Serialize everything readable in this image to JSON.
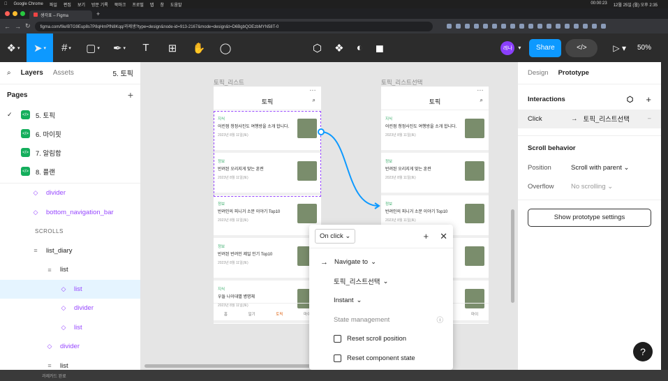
{
  "menubar": {
    "apple": "",
    "app": "Google Chrome",
    "items": [
      "파일",
      "편집",
      "보기",
      "방문 기록",
      "북마크",
      "프로필",
      "탭",
      "창",
      "도움말"
    ],
    "time": "00:00:23",
    "clock": "12월 25일 (월) 오후 2:35"
  },
  "browser": {
    "tab_title": "생각표 – Figma",
    "url": "figma.com/file/BTG9Eup8s7P8qHmPfN8Kqq/과제생?type=design&node-id=913-2167&mode=design&t=D6BgbQOEzbMYN58T-0"
  },
  "toolbar": {
    "zoom": "50%",
    "share": "Share",
    "avatar": "레나"
  },
  "left_panel": {
    "tabs": {
      "layers": "Layers",
      "assets": "Assets",
      "page": "5. 토픽"
    },
    "pages_title": "Pages",
    "pages": [
      {
        "label": "5. 토픽",
        "current": true
      },
      {
        "label": "6. 마이핏",
        "current": false
      },
      {
        "label": "7. 알림함",
        "current": false
      },
      {
        "label": "8. 플랜",
        "current": false
      }
    ],
    "layers": [
      {
        "label": "divider",
        "indent": 52,
        "icon": "◇",
        "purple": true,
        "selected": false
      },
      {
        "label": "bottom_navigation_bar",
        "indent": 52,
        "icon": "◇",
        "purple": true,
        "selected": false
      },
      {
        "label": "SCROLLS",
        "indent": 50,
        "icon": "",
        "purple": false,
        "selected": false,
        "head": true
      },
      {
        "label": "list_diary",
        "indent": 52,
        "icon": "≡",
        "purple": false,
        "selected": false
      },
      {
        "label": "list",
        "indent": 72,
        "icon": "≡",
        "purple": false,
        "selected": false
      },
      {
        "label": "list",
        "indent": 92,
        "icon": "◇",
        "purple": true,
        "selected": true
      },
      {
        "label": "divider",
        "indent": 92,
        "icon": "◇",
        "purple": true,
        "selected": false
      },
      {
        "label": "list",
        "indent": 92,
        "icon": "◇",
        "purple": true,
        "selected": false
      },
      {
        "label": "divider",
        "indent": 72,
        "icon": "◇",
        "purple": true,
        "selected": false
      },
      {
        "label": "list",
        "indent": 72,
        "icon": "≡",
        "purple": false,
        "selected": false
      }
    ]
  },
  "canvas": {
    "frame1": {
      "label": "토픽_리스트",
      "title": "토픽"
    },
    "frame2": {
      "label": "토픽_리스트선택",
      "title": "토픽"
    },
    "cards": [
      {
        "cat": "지식",
        "title": "어린점 청정사진도 여행방을 소개 합니다.",
        "date": "2023년 8월 11일(토)"
      },
      {
        "cat": "정보",
        "title": "반려된 오리지게 맞는 훈련",
        "date": "2023년 8월 11일(토)"
      },
      {
        "cat": "정보",
        "title": "반려인의 피니거 소문 이야기 Top10",
        "date": "2023년 8월 11일(토)"
      },
      {
        "cat": "정보",
        "title": "반려된 반려인 제일 인기 Top10",
        "date": "2023년 8월 11일(토)"
      },
      {
        "cat": "지식",
        "title": "우들 나이대별 병명체",
        "date": "2023년 8월 11일(토)"
      }
    ],
    "nav": [
      "홈",
      "일기",
      "토픽",
      "마이"
    ]
  },
  "interaction_popup": {
    "trigger": "On click",
    "action": "Navigate to",
    "destination": "토픽_리스트선택",
    "animation": "Instant",
    "state_title": "State management",
    "opt1": "Reset scroll position",
    "opt2": "Reset component state"
  },
  "right_panel": {
    "tabs": {
      "design": "Design",
      "prototype": "Prototype"
    },
    "interactions_title": "Interactions",
    "interaction": {
      "trigger": "Click",
      "target": "토픽_리스트선택"
    },
    "scroll_title": "Scroll behavior",
    "position_label": "Position",
    "position_value": "Scroll with parent",
    "overflow_label": "Overflow",
    "overflow_value": "No scrolling",
    "show_settings": "Show prototype settings"
  },
  "dock": {
    "label": "과제카드 완료"
  },
  "colors": {
    "accent": "#0d99ff",
    "component": "#9747ff",
    "green": "#14ae5c"
  }
}
